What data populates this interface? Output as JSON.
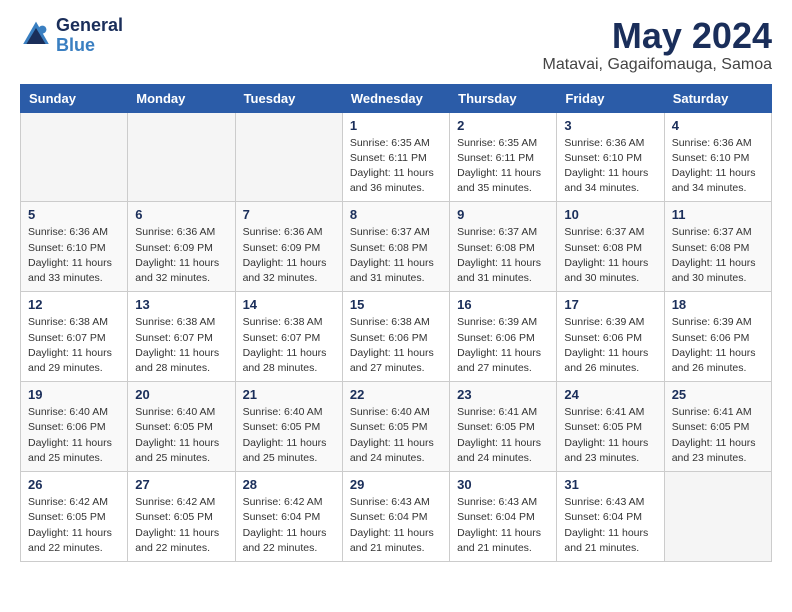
{
  "header": {
    "logo_general": "General",
    "logo_blue": "Blue",
    "title": "May 2024",
    "location": "Matavai, Gagaifomauga, Samoa"
  },
  "weekdays": [
    "Sunday",
    "Monday",
    "Tuesday",
    "Wednesday",
    "Thursday",
    "Friday",
    "Saturday"
  ],
  "weeks": [
    [
      {
        "day": "",
        "info": ""
      },
      {
        "day": "",
        "info": ""
      },
      {
        "day": "",
        "info": ""
      },
      {
        "day": "1",
        "info": "Sunrise: 6:35 AM\nSunset: 6:11 PM\nDaylight: 11 hours and 36 minutes."
      },
      {
        "day": "2",
        "info": "Sunrise: 6:35 AM\nSunset: 6:11 PM\nDaylight: 11 hours and 35 minutes."
      },
      {
        "day": "3",
        "info": "Sunrise: 6:36 AM\nSunset: 6:10 PM\nDaylight: 11 hours and 34 minutes."
      },
      {
        "day": "4",
        "info": "Sunrise: 6:36 AM\nSunset: 6:10 PM\nDaylight: 11 hours and 34 minutes."
      }
    ],
    [
      {
        "day": "5",
        "info": "Sunrise: 6:36 AM\nSunset: 6:10 PM\nDaylight: 11 hours and 33 minutes."
      },
      {
        "day": "6",
        "info": "Sunrise: 6:36 AM\nSunset: 6:09 PM\nDaylight: 11 hours and 32 minutes."
      },
      {
        "day": "7",
        "info": "Sunrise: 6:36 AM\nSunset: 6:09 PM\nDaylight: 11 hours and 32 minutes."
      },
      {
        "day": "8",
        "info": "Sunrise: 6:37 AM\nSunset: 6:08 PM\nDaylight: 11 hours and 31 minutes."
      },
      {
        "day": "9",
        "info": "Sunrise: 6:37 AM\nSunset: 6:08 PM\nDaylight: 11 hours and 31 minutes."
      },
      {
        "day": "10",
        "info": "Sunrise: 6:37 AM\nSunset: 6:08 PM\nDaylight: 11 hours and 30 minutes."
      },
      {
        "day": "11",
        "info": "Sunrise: 6:37 AM\nSunset: 6:08 PM\nDaylight: 11 hours and 30 minutes."
      }
    ],
    [
      {
        "day": "12",
        "info": "Sunrise: 6:38 AM\nSunset: 6:07 PM\nDaylight: 11 hours and 29 minutes."
      },
      {
        "day": "13",
        "info": "Sunrise: 6:38 AM\nSunset: 6:07 PM\nDaylight: 11 hours and 28 minutes."
      },
      {
        "day": "14",
        "info": "Sunrise: 6:38 AM\nSunset: 6:07 PM\nDaylight: 11 hours and 28 minutes."
      },
      {
        "day": "15",
        "info": "Sunrise: 6:38 AM\nSunset: 6:06 PM\nDaylight: 11 hours and 27 minutes."
      },
      {
        "day": "16",
        "info": "Sunrise: 6:39 AM\nSunset: 6:06 PM\nDaylight: 11 hours and 27 minutes."
      },
      {
        "day": "17",
        "info": "Sunrise: 6:39 AM\nSunset: 6:06 PM\nDaylight: 11 hours and 26 minutes."
      },
      {
        "day": "18",
        "info": "Sunrise: 6:39 AM\nSunset: 6:06 PM\nDaylight: 11 hours and 26 minutes."
      }
    ],
    [
      {
        "day": "19",
        "info": "Sunrise: 6:40 AM\nSunset: 6:06 PM\nDaylight: 11 hours and 25 minutes."
      },
      {
        "day": "20",
        "info": "Sunrise: 6:40 AM\nSunset: 6:05 PM\nDaylight: 11 hours and 25 minutes."
      },
      {
        "day": "21",
        "info": "Sunrise: 6:40 AM\nSunset: 6:05 PM\nDaylight: 11 hours and 25 minutes."
      },
      {
        "day": "22",
        "info": "Sunrise: 6:40 AM\nSunset: 6:05 PM\nDaylight: 11 hours and 24 minutes."
      },
      {
        "day": "23",
        "info": "Sunrise: 6:41 AM\nSunset: 6:05 PM\nDaylight: 11 hours and 24 minutes."
      },
      {
        "day": "24",
        "info": "Sunrise: 6:41 AM\nSunset: 6:05 PM\nDaylight: 11 hours and 23 minutes."
      },
      {
        "day": "25",
        "info": "Sunrise: 6:41 AM\nSunset: 6:05 PM\nDaylight: 11 hours and 23 minutes."
      }
    ],
    [
      {
        "day": "26",
        "info": "Sunrise: 6:42 AM\nSunset: 6:05 PM\nDaylight: 11 hours and 22 minutes."
      },
      {
        "day": "27",
        "info": "Sunrise: 6:42 AM\nSunset: 6:05 PM\nDaylight: 11 hours and 22 minutes."
      },
      {
        "day": "28",
        "info": "Sunrise: 6:42 AM\nSunset: 6:04 PM\nDaylight: 11 hours and 22 minutes."
      },
      {
        "day": "29",
        "info": "Sunrise: 6:43 AM\nSunset: 6:04 PM\nDaylight: 11 hours and 21 minutes."
      },
      {
        "day": "30",
        "info": "Sunrise: 6:43 AM\nSunset: 6:04 PM\nDaylight: 11 hours and 21 minutes."
      },
      {
        "day": "31",
        "info": "Sunrise: 6:43 AM\nSunset: 6:04 PM\nDaylight: 11 hours and 21 minutes."
      },
      {
        "day": "",
        "info": ""
      }
    ]
  ]
}
